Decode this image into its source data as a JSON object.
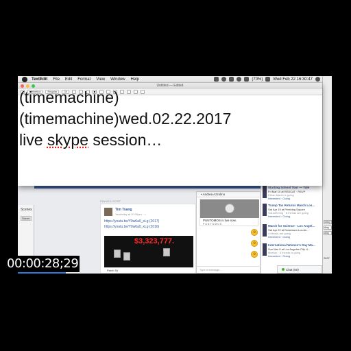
{
  "menubar": {
    "app": "TextEdit",
    "menus": [
      "File",
      "Edit",
      "Format",
      "View",
      "Window",
      "Help"
    ],
    "clock": "Wed Feb 22  16:30:47",
    "battery": "(70%)"
  },
  "textedit": {
    "title": "Untitled — Edited",
    "toolbar": {
      "style": "Helvetica",
      "weight": "Regular",
      "size": "30"
    },
    "lines": [
      "(timemachine)",
      "(timemachine)wed.02.22.2017",
      "live skype session…"
    ],
    "misspelled_1": "skype"
  },
  "editor_panel": {
    "label": "Scenes",
    "row": "Scene",
    "add": "+"
  },
  "facebook": {
    "pinned_label": "PINNED POST",
    "post": {
      "author": "Tim Tsang",
      "meta": "Yesterday at 10:26pm · ⌂",
      "link1": "https://youtu.be/Y0w6a0_xLg (2017)",
      "link2": "https://youtu.be/Y0w6a0_xLg (2016)",
      "video_text": "$3,323,777.",
      "footer": "Parch Ss"
    },
    "chat": {
      "header": "• Andrea Azzolino",
      "card_caption": "PUNTOMOS is live now.",
      "card_brand": "PUNTOMOS",
      "input_placeholder": "Type a message..."
    },
    "events": [
      {
        "title": "Starting School Tour — Yale",
        "when": "Fri Mar 10 at REDCAT · RSVP",
        "who": "Ethan Martin is going",
        "action": "Interested · Going"
      },
      {
        "title": "Trump Tax Returns March Los...",
        "when": "Sat Apr 15 at Pershing Square",
        "who": "Volunteering · 8 friends are going",
        "action": "Interested · Going"
      },
      {
        "title": "March for Science - Los Angel...",
        "when": "Sat Apr 22 at Downtown Los An...",
        "who": "4 friends are going",
        "action": "Interested · Going"
      },
      {
        "title": "International Women's Day Ma...",
        "when": "Sun Mar 5 at Los Angeles City H...",
        "who": "Meetup · 5 friends is going",
        "action": "Interested · Going"
      }
    ],
    "chat_bar": "Chat (60)"
  },
  "right_panel": {
    "buttons": [
      "nding",
      "ding",
      "ding"
    ],
    "counter": "2637"
  },
  "video_timecode": "00:00:28;29"
}
